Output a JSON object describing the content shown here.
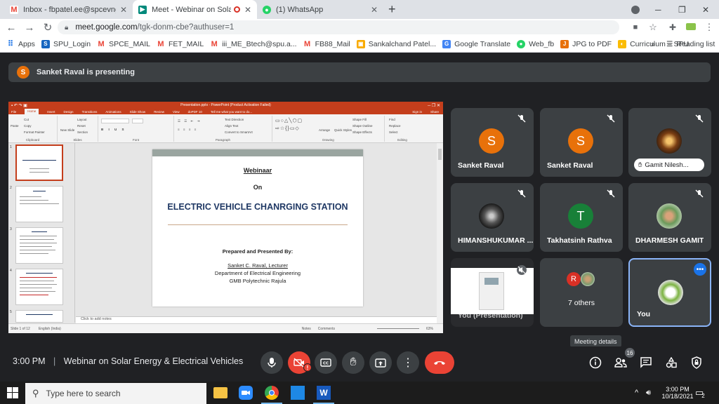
{
  "browser": {
    "tabs": [
      {
        "title": "Inbox - fbpatel.ee@spcevng.ac.in",
        "icon": "gmail-icon"
      },
      {
        "title": "Meet - Webinar on Solar Ene",
        "icon": "meet-icon"
      },
      {
        "title": "(1) WhatsApp",
        "icon": "whatsapp-icon"
      }
    ],
    "url_host": "meet.google.com",
    "url_path": "/tgk-donm-cbe?authuser=1",
    "bookmarks": [
      "Apps",
      "SPU_Login",
      "SPCE_MAIL",
      "FET_MAIL",
      "iii_ME_Btech@spu.a...",
      "FB88_Mail",
      "Sankalchand Patel...",
      "Google Translate",
      "Web_fb",
      "JPG to PDF",
      "Curriculum – SPU"
    ],
    "reading_list": "Reading list",
    "accent": "#1a73e8"
  },
  "meet": {
    "presenting_banner": "Sanket Raval is presenting",
    "presenter_initial": "S",
    "ppt": {
      "window_title": "Presentation.pptx - PowerPoint (Product Activation Failed)",
      "tabs": [
        "File",
        "Home",
        "Insert",
        "Design",
        "Transitions",
        "Animations",
        "Slide Show",
        "Review",
        "View",
        "doPDF 10",
        "Tell me what you want to do..."
      ],
      "signin": "Sign in",
      "share": "Share",
      "groups": [
        "Clipboard",
        "Slides",
        "Font",
        "Paragraph",
        "Drawing",
        "Editing"
      ],
      "clipboard_items": [
        "Cut",
        "Copy",
        "Format Painter",
        "Paste"
      ],
      "slides_items": [
        "Layout",
        "Reset",
        "Section",
        "New Slide"
      ],
      "para_items": [
        "Text Direction",
        "Align Text",
        "Convert to SmartArt"
      ],
      "draw_items": [
        "Arrange",
        "Quick Styles",
        "Shape Fill",
        "Shape Outline",
        "Shape Effects"
      ],
      "edit_items": [
        "Find",
        "Replace",
        "Select"
      ],
      "slide": {
        "line1": "Webinaar",
        "line2": "On",
        "title": "ELECTRIC VEHICLE CHANRGING STATION",
        "prepared": "Prepared and Presented By:",
        "author": "Sanket C. Raval, Lecturer",
        "dept": "Department of Electrical Engineering",
        "inst": "GMB Polytechnic Rajula"
      },
      "thumb_numbers": [
        "1",
        "2",
        "3",
        "4",
        "5"
      ],
      "notes_placeholder": "Click to add notes",
      "status_left": "Slide 1 of 12",
      "status_lang": "English (India)",
      "status_notes": "Notes",
      "status_comments": "Comments",
      "zoom": "63%"
    },
    "tiles": [
      {
        "name": "Sanket Raval",
        "initial": "S",
        "color": "#e8710a"
      },
      {
        "name": "Sanket Raval",
        "initial": "S",
        "color": "#e8710a"
      },
      {
        "name": "Gamit Nilesh..."
      },
      {
        "name": "HIMANSHUKUMAR ..."
      },
      {
        "name": "Takhatsinh Rathva",
        "initial": "T",
        "color": "#188038"
      },
      {
        "name": "DHARMESH GAMIT"
      },
      {
        "name": "You (Presentation)"
      },
      {
        "name": "7 others",
        "initial": "R",
        "color": "#d93025"
      },
      {
        "name": "You"
      }
    ],
    "time": "3:00 PM",
    "meeting_title": "Webinar on Solar Energy & Electrical Vehicles",
    "tooltip": "Meeting details",
    "participants_count": "16",
    "end_call_color": "#ea4335"
  },
  "taskbar": {
    "search_placeholder": "Type here to search",
    "clock_time": "3:00 PM",
    "clock_date": "10/18/2021",
    "notif_count": "2"
  }
}
